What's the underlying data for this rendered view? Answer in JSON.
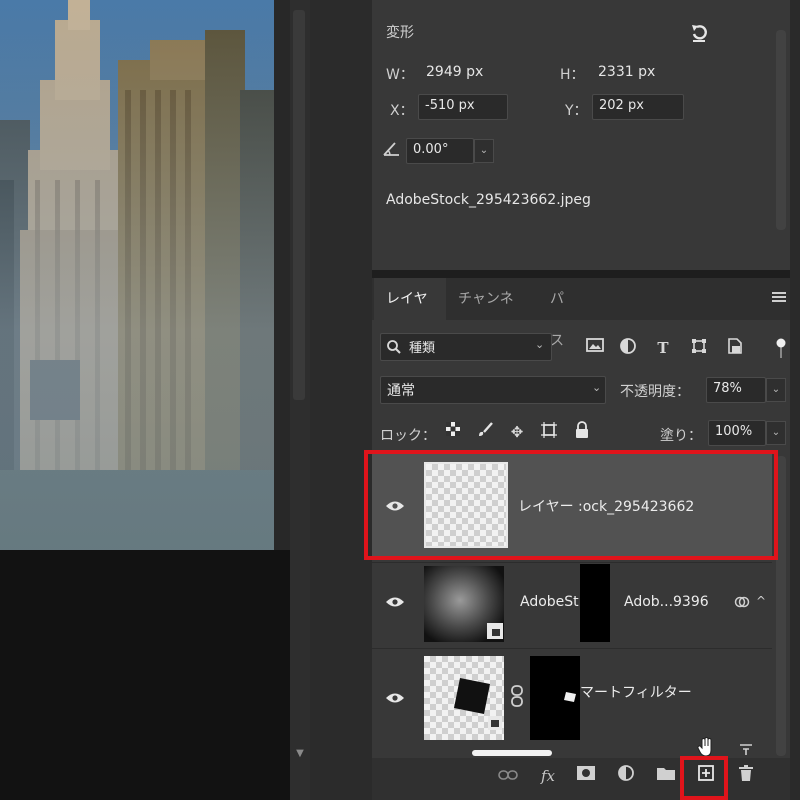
{
  "properties": {
    "title": "変形",
    "w_label": "W：",
    "w_value": "2949 px",
    "h_label": "H：",
    "h_value": "2331 px",
    "x_label": "X：",
    "x_value": "-510 px",
    "y_label": "Y：",
    "y_value": "202 px",
    "angle_value": "0.00°",
    "filename": "AdobeStock_295423662.jpeg"
  },
  "layers_panel": {
    "tabs": [
      {
        "label": "レイヤー",
        "active": true
      },
      {
        "label": "チャンネル",
        "active": false
      },
      {
        "label": "パス",
        "active": false
      }
    ],
    "filter_kind": "種類",
    "blend_mode": "通常",
    "opacity_label": "不透明度：",
    "opacity_value": "78%",
    "lock_label": "ロック：",
    "fill_label": "塗り：",
    "fill_value": "100%",
    "layers": [
      {
        "name": "レイヤー :ock_295423662",
        "selected": true
      },
      {
        "name_left": "AdobeSt",
        "name_right": "Adob...9396"
      },
      {
        "name": "マートフィルター"
      }
    ]
  },
  "colors": {
    "highlight": "#e0141b",
    "panel_bg": "#383838",
    "selected_row": "#525252"
  },
  "icons": [
    "rotate-reset-icon",
    "angle-icon",
    "search-icon",
    "image-filter-icon",
    "adjustment-filter-icon",
    "type-filter-icon",
    "shape-filter-icon",
    "smart-object-filter-icon",
    "filter-toggle-icon",
    "lock-transparent-icon",
    "lock-paint-icon",
    "lock-move-icon",
    "lock-artboard-icon",
    "lock-all-icon",
    "eye-icon",
    "link-icon",
    "fx-icon",
    "mask-icon",
    "adjustment-icon",
    "folder-icon",
    "new-layer-icon",
    "trash-icon",
    "hand-cursor-icon",
    "panel-menu-icon"
  ]
}
